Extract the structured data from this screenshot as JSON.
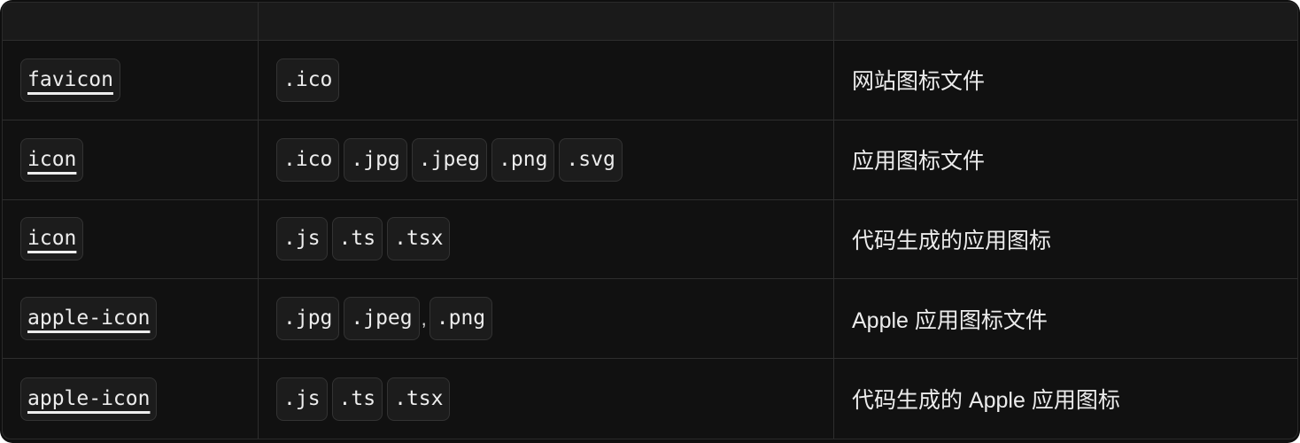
{
  "table": {
    "headers": [
      "",
      "",
      ""
    ],
    "rows": [
      {
        "name": "favicon",
        "exts": [
          ".ico"
        ],
        "separators": [],
        "description": "网站图标文件"
      },
      {
        "name": "icon",
        "exts": [
          ".ico",
          ".jpg",
          ".jpeg",
          ".png",
          ".svg"
        ],
        "separators": [],
        "description": "应用图标文件"
      },
      {
        "name": "icon",
        "exts": [
          ".js",
          ".ts",
          ".tsx"
        ],
        "separators": [],
        "description": "代码生成的应用图标"
      },
      {
        "name": "apple-icon",
        "exts": [
          ".jpg",
          ".jpeg",
          ".png"
        ],
        "separators": [
          "",
          ","
        ],
        "description": "Apple 应用图标文件"
      },
      {
        "name": "apple-icon",
        "exts": [
          ".js",
          ".ts",
          ".tsx"
        ],
        "separators": [],
        "description": "代码生成的 Apple 应用图标"
      }
    ]
  },
  "colors": {
    "background": "#111111",
    "header": "#1a1a1a",
    "border": "#2e2e2e",
    "code_bg": "#1c1c1c",
    "text": "#ededed"
  }
}
